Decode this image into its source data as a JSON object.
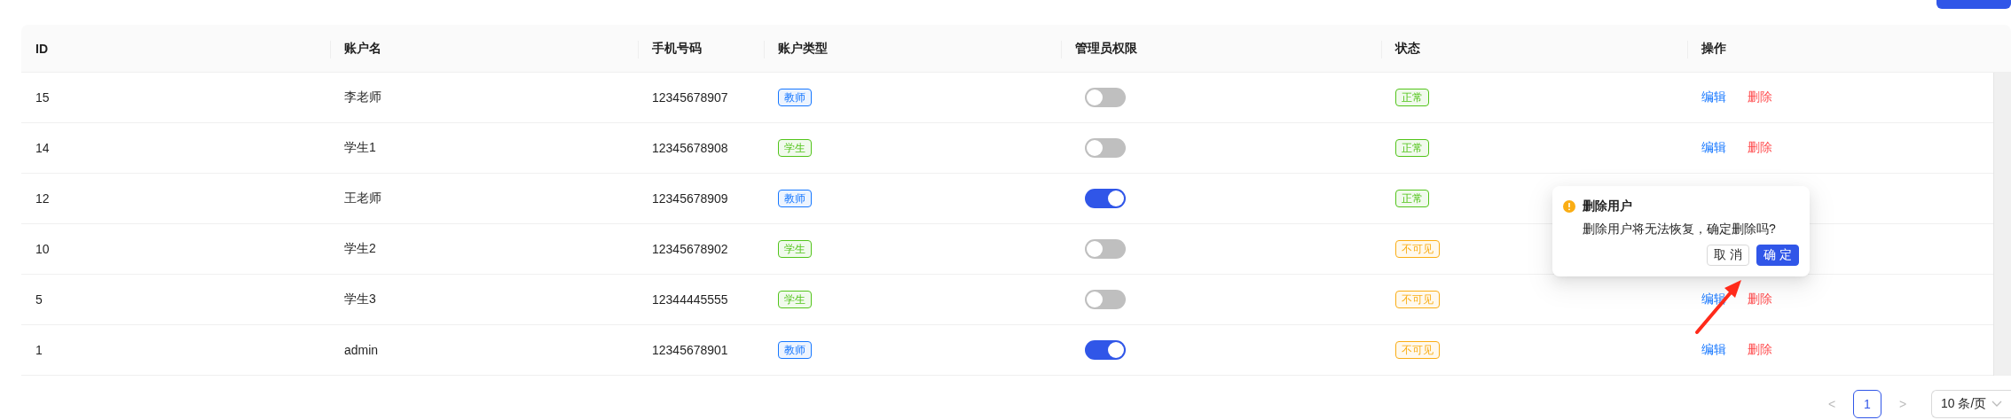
{
  "table": {
    "columns": [
      "ID",
      "账户名",
      "手机号码",
      "账户类型",
      "管理员权限",
      "状态",
      "操作"
    ],
    "rows": [
      {
        "id": "15",
        "name": "李老师",
        "phone": "12345678907",
        "type": {
          "label": "教师",
          "color": "#1677ff"
        },
        "admin": false,
        "status": {
          "label": "正常",
          "color": "#52c41a"
        },
        "actions": [
          "编辑",
          "删除"
        ]
      },
      {
        "id": "14",
        "name": "学生1",
        "phone": "12345678908",
        "type": {
          "label": "学生",
          "color": "#52c41a"
        },
        "admin": false,
        "status": {
          "label": "正常",
          "color": "#52c41a"
        },
        "actions": [
          "编辑",
          "删除"
        ]
      },
      {
        "id": "12",
        "name": "王老师",
        "phone": "12345678909",
        "type": {
          "label": "教师",
          "color": "#1677ff"
        },
        "admin": true,
        "status": {
          "label": "正常",
          "color": "#52c41a"
        },
        "actions": []
      },
      {
        "id": "10",
        "name": "学生2",
        "phone": "12345678902",
        "type": {
          "label": "学生",
          "color": "#52c41a"
        },
        "admin": false,
        "status": {
          "label": "不可见",
          "color": "#faad14"
        },
        "actions": []
      },
      {
        "id": "5",
        "name": "学生3",
        "phone": "12344445555",
        "type": {
          "label": "学生",
          "color": "#52c41a"
        },
        "admin": false,
        "status": {
          "label": "不可见",
          "color": "#faad14"
        },
        "actions": [
          "编辑",
          "删除"
        ]
      },
      {
        "id": "1",
        "name": "admin",
        "phone": "12345678901",
        "type": {
          "label": "教师",
          "color": "#1677ff"
        },
        "admin": true,
        "status": {
          "label": "不可见",
          "color": "#faad14"
        },
        "actions": [
          "编辑",
          "删除"
        ]
      }
    ]
  },
  "popconfirm": {
    "title": "删除用户",
    "message": "删除用户将无法恢复，确定删除吗?",
    "cancel": "取 消",
    "ok": "确 定"
  },
  "pagination": {
    "prev": "<",
    "pages": [
      {
        "label": "1",
        "selected": true
      }
    ],
    "next": ">",
    "page_size": "10 条/页"
  }
}
